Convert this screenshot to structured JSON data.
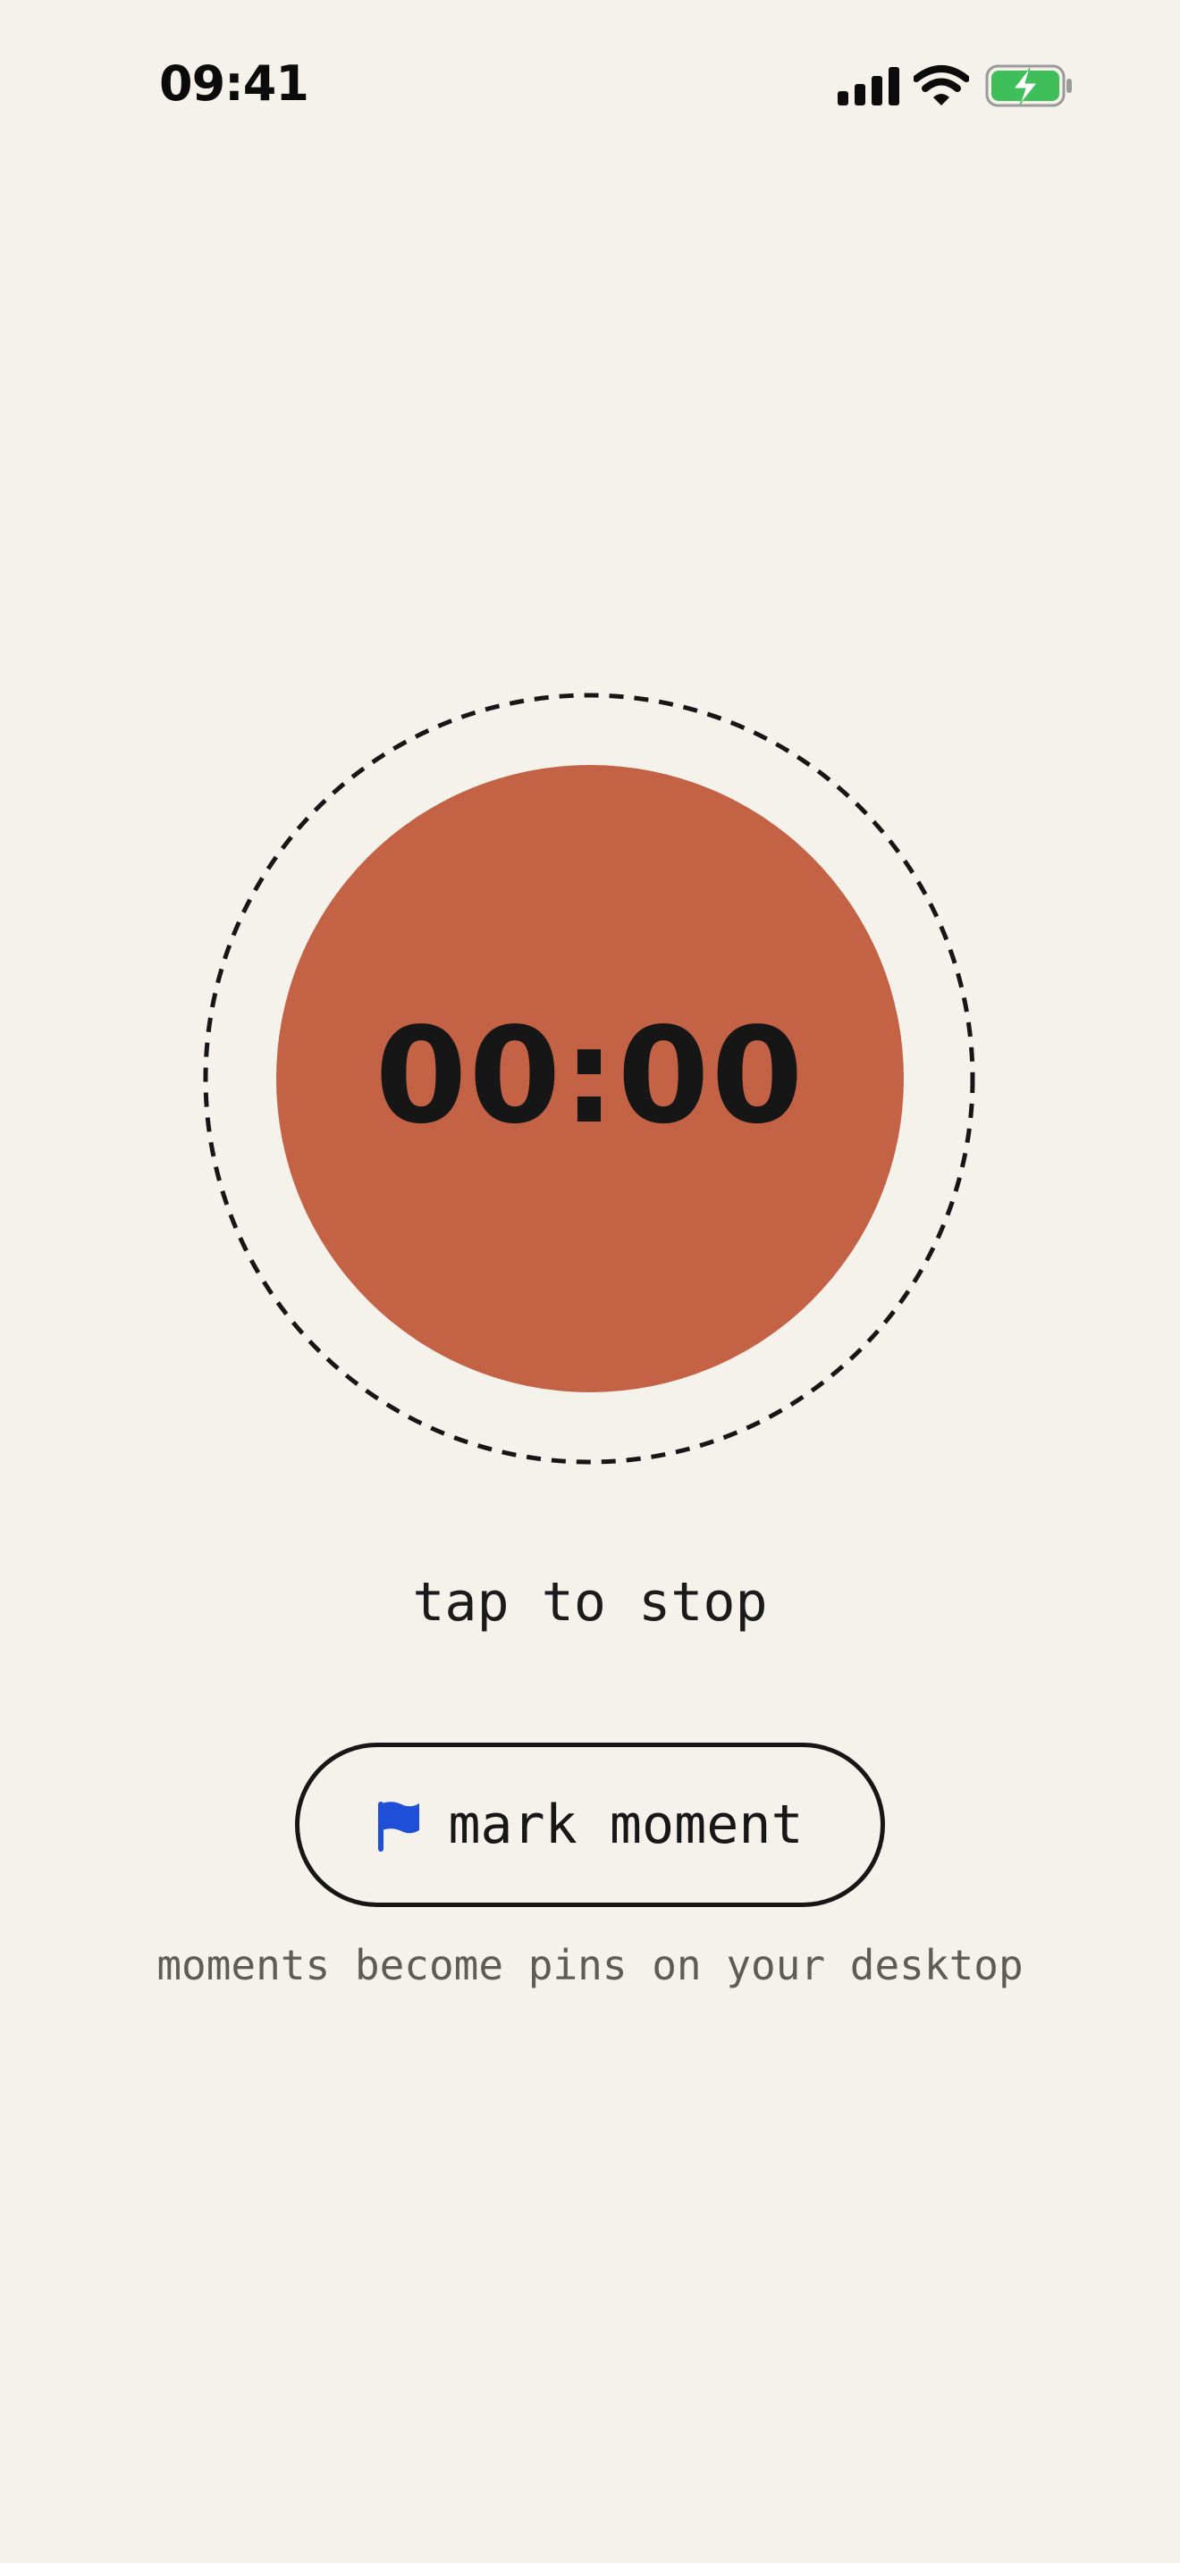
{
  "status_bar": {
    "time": "09:41",
    "icons": [
      "cellular-signal-icon",
      "wifi-icon",
      "battery-charging-icon"
    ],
    "battery_color": "#3fbf5a"
  },
  "timer": {
    "value": "00:00",
    "button_color": "#c46245",
    "ring_style": "dashed"
  },
  "hint": "tap to stop",
  "mark_button": {
    "label": "mark moment",
    "icon": "flag-icon",
    "icon_color": "#1f4fd8"
  },
  "caption": "moments become pins on your desktop",
  "colors": {
    "background": "#f5f2ec",
    "text": "#171717",
    "muted_text": "#5f5c57"
  }
}
